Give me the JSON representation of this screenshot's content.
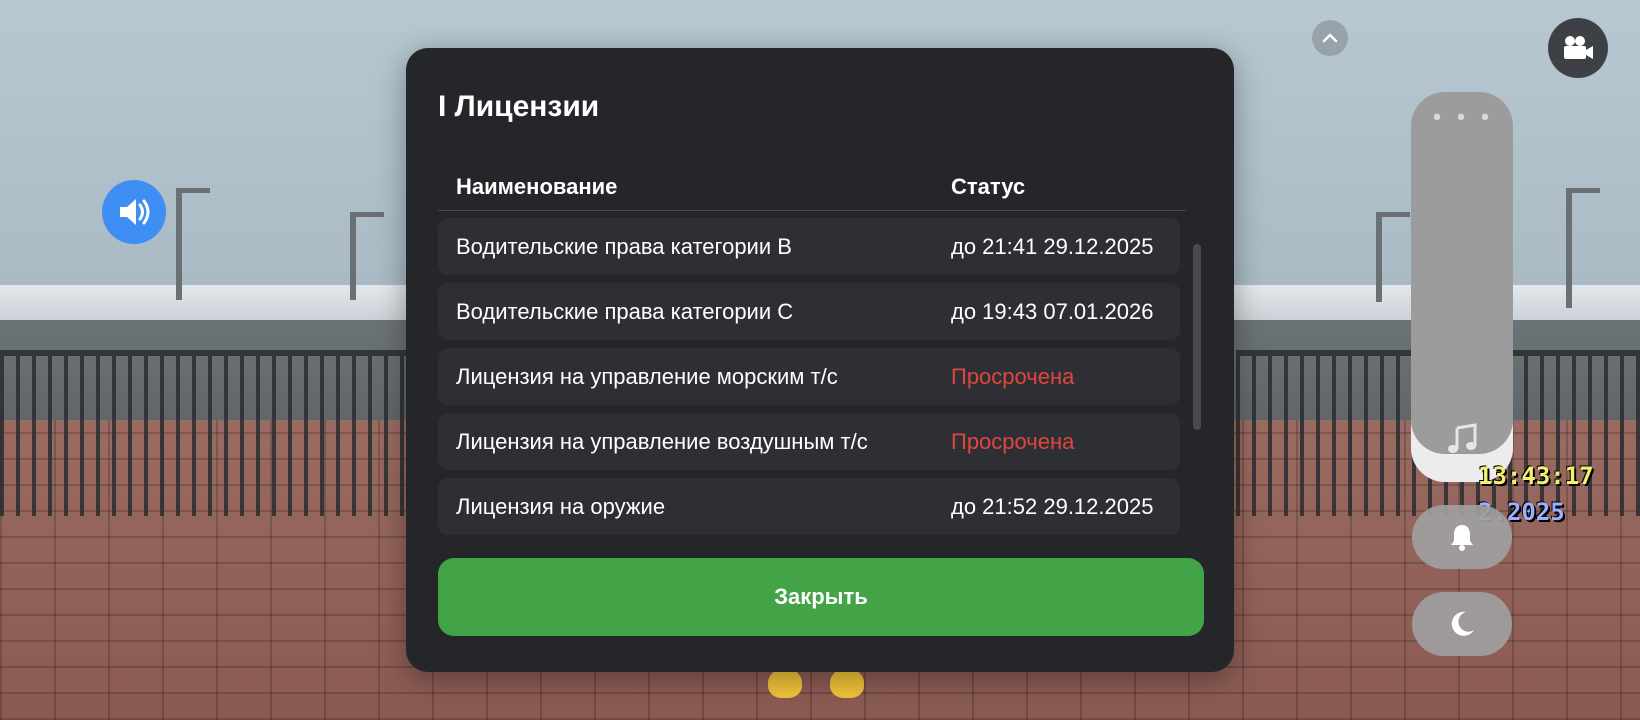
{
  "modal": {
    "title": "I Лицензии",
    "columns": {
      "name": "Наименование",
      "status": "Статус"
    },
    "rows": [
      {
        "name": "Водительские права категории B",
        "status": "до 21:41 29.12.2025",
        "expired": false
      },
      {
        "name": "Водительские права категории C",
        "status": "до 19:43 07.01.2026",
        "expired": false
      },
      {
        "name": "Лицензия на управление морским т/с",
        "status": "Просрочена",
        "expired": true
      },
      {
        "name": "Лицензия на управление воздушным т/с",
        "status": "Просрочена",
        "expired": true
      },
      {
        "name": "Лицензия на оружие",
        "status": "до 21:52 29.12.2025",
        "expired": false
      }
    ],
    "close_label": "Закрыть"
  },
  "hud": {
    "time": "13:43:17",
    "date": "2.2025"
  },
  "icons": {
    "sound": "speaker-icon",
    "camera": "video-camera-icon",
    "chevron": "chevron-up-icon",
    "music": "music-note-icon",
    "bell": "bell-icon",
    "moon": "moon-icon",
    "menu": "more-dots-icon"
  },
  "colors": {
    "modal_bg": "#25262a",
    "row_bg": "#2e2f34",
    "close_button": "#42a347",
    "expired_text": "#e0463f",
    "sound_button": "#3f8ef3"
  }
}
